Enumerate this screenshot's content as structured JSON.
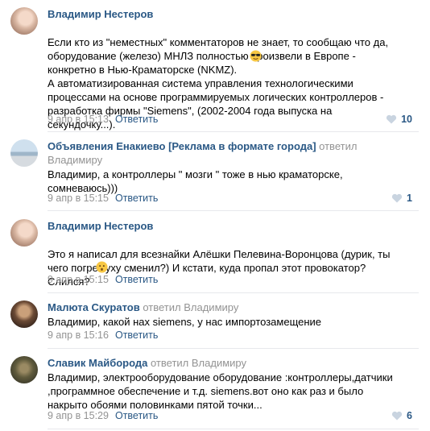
{
  "comments": [
    {
      "author": "Владимир Нестеров",
      "replied": "",
      "replied_to": "",
      "text": "Если кто из \"неместных\" комментаторов не знает, то сообщаю что да, оборудование (железо) МНЛЗ полностью произвели в Европе - конкретно в Нью-Краматорске (NKMZ).\nА автоматизированная система управления технологическими процессами на основе программируемых логических контроллеров - разработка фирмы \"Siemens\", (2002-2004 года выпуска на секундочку...).",
      "emoji": "sunglasses-emoji",
      "date": "9 апр в 15:13",
      "reply": "Ответить",
      "likes": "10"
    },
    {
      "author": "Объявления Енакиево [Реклама в формате города]",
      "replied": "ответил",
      "replied_to": "Владимиру",
      "text": "Владимир, а контроллеры \" мозги \" тоже в нью краматорске, сомневаюсь)))",
      "emoji": "",
      "date": "9 апр в 15:15",
      "reply": "Ответить",
      "likes": "1"
    },
    {
      "author": "Владимир Нестеров",
      "replied": "",
      "replied_to": "",
      "text": "Это я написал для всезнайки Алёшки Пелевина-Воронцова (дурик, ты чего погремуху сменил?) И кстати, куда пропал этот провокатор? Слился?",
      "emoji": "hushed-emoji",
      "date": "9 апр в 15:15",
      "reply": "Ответить",
      "likes": ""
    },
    {
      "author": "Малюта Скуратов",
      "replied": "ответил",
      "replied_to": "Владимиру",
      "text": "Владимир, какой нах siemens, у нас импортозамещение",
      "emoji": "",
      "date": "9 апр в 15:16",
      "reply": "Ответить",
      "likes": ""
    },
    {
      "author": "Славик Майборода",
      "replied": "ответил",
      "replied_to": "Владимиру",
      "text": "Владимир, электрооборудование оборудование :контроллеры,датчики ,программное обеспечение и т.д. siemens.вот оно как раз и было накрыто обоями половинками пятой точки...",
      "emoji": "",
      "date": "9 апр в 15:29",
      "reply": "Ответить",
      "likes": "6"
    }
  ],
  "colors": {
    "link": "#2a5885",
    "meta": "#939393",
    "divider": "#e7e8ec"
  }
}
